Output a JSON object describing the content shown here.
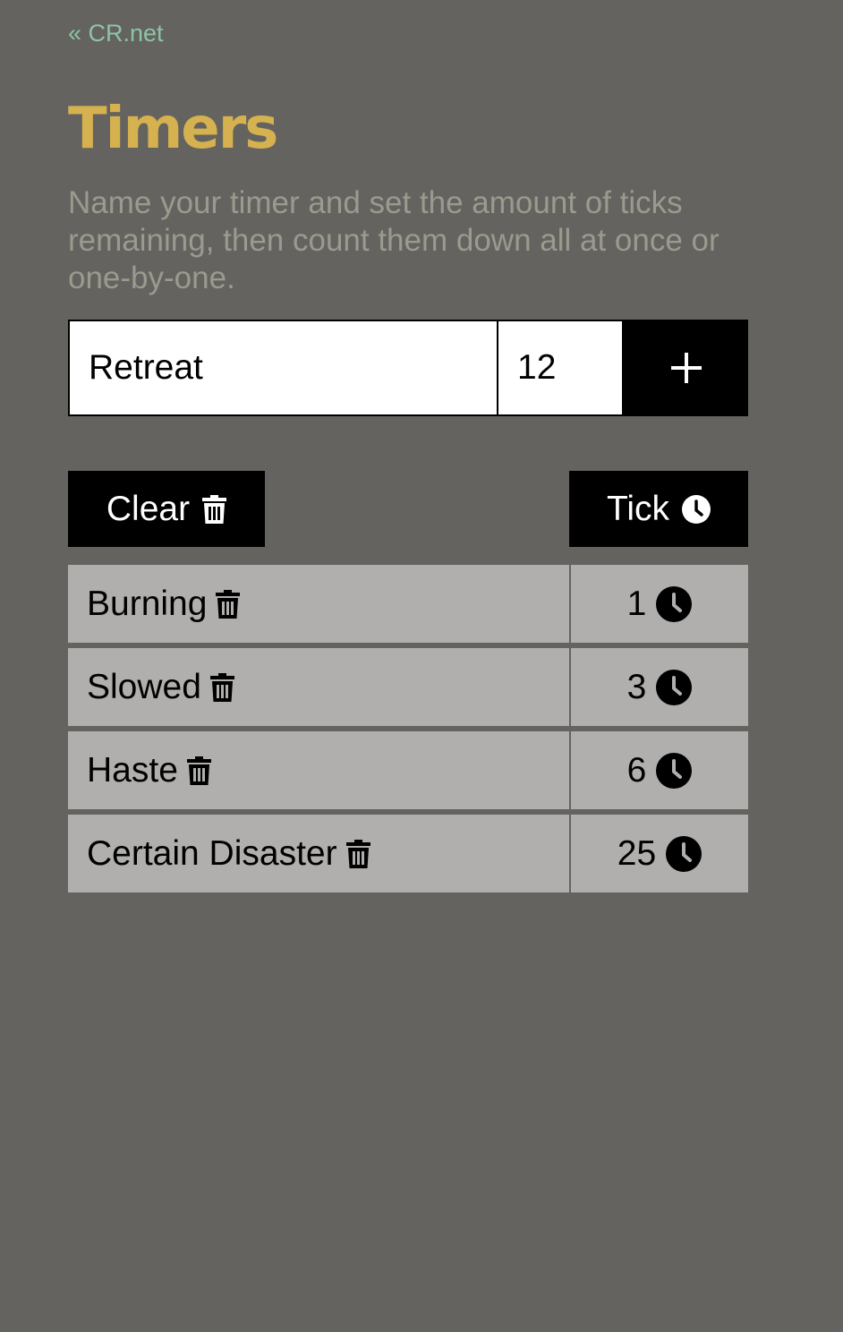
{
  "nav": {
    "back_link": "« CR.net"
  },
  "header": {
    "title": "Timers",
    "description": "Name your timer and set the amount of ticks remaining, then count them down all at once or one-by-one."
  },
  "form": {
    "name_value": "Retreat",
    "ticks_value": "12",
    "add_icon": "plus-icon"
  },
  "toolbar": {
    "clear_label": "Clear",
    "clear_icon": "trash-icon",
    "tick_label": "Tick",
    "tick_icon": "clock-icon"
  },
  "timers": [
    {
      "name": "Burning",
      "ticks": "1"
    },
    {
      "name": "Slowed",
      "ticks": "3"
    },
    {
      "name": "Haste",
      "ticks": "6"
    },
    {
      "name": "Certain Disaster",
      "ticks": "25"
    }
  ],
  "colors": {
    "background": "#64635f",
    "title": "#d5b14f",
    "link": "#8fc3a5",
    "description": "#9a9a8e",
    "row": "#b0afad",
    "button": "#000000"
  }
}
